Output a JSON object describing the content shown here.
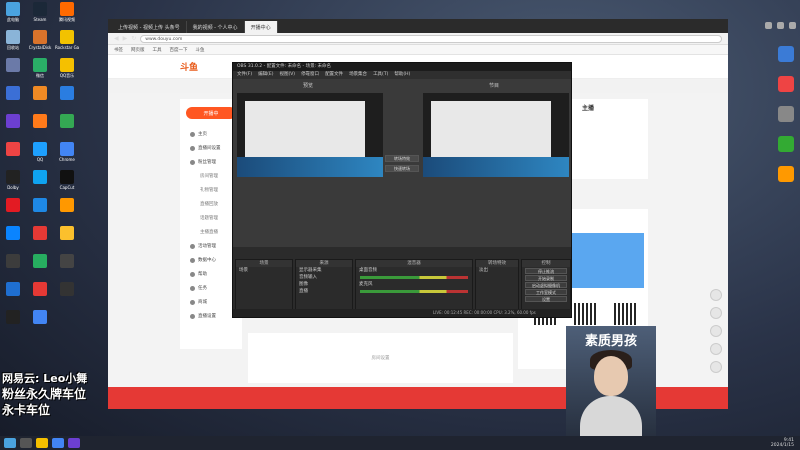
{
  "desktop": {
    "icons": [
      {
        "label": "此电脑",
        "color": "#4aa3df"
      },
      {
        "label": "Steam",
        "color": "#1b2838"
      },
      {
        "label": "腾讯视频",
        "color": "#ff6a00"
      },
      {
        "label": "",
        "color": ""
      },
      {
        "label": "回收站",
        "color": "#8ab4d8"
      },
      {
        "label": "CrystalDisk",
        "color": "#d9732b"
      },
      {
        "label": "Rockstar Games",
        "color": "#f2c200"
      },
      {
        "label": "",
        "color": ""
      },
      {
        "label": "",
        "color": "#6b7aa8"
      },
      {
        "label": "微信",
        "color": "#2aae67"
      },
      {
        "label": "QQ音乐",
        "color": "#f5c000"
      },
      {
        "label": "",
        "color": ""
      },
      {
        "label": "",
        "color": "#3b6fd6"
      },
      {
        "label": "",
        "color": "#f08a24"
      },
      {
        "label": "",
        "color": "#2a7de1"
      },
      {
        "label": "",
        "color": ""
      },
      {
        "label": "",
        "color": "#6c3fd1"
      },
      {
        "label": "",
        "color": "#ff7a1a"
      },
      {
        "label": "",
        "color": "#34a853"
      },
      {
        "label": "",
        "color": ""
      },
      {
        "label": "",
        "color": "#e44"
      },
      {
        "label": "QQ",
        "color": "#1ea0ff"
      },
      {
        "label": "Chrome",
        "color": "#4285f4"
      },
      {
        "label": "",
        "color": ""
      },
      {
        "label": "Dolby",
        "color": "#222"
      },
      {
        "label": "",
        "color": "#0fa3f0"
      },
      {
        "label": "CapCut",
        "color": "#111"
      },
      {
        "label": "",
        "color": ""
      },
      {
        "label": "",
        "color": "#e31b23"
      },
      {
        "label": "",
        "color": "#1e88e5"
      },
      {
        "label": "",
        "color": "#ff9800"
      },
      {
        "label": "",
        "color": ""
      },
      {
        "label": "",
        "color": "#0a84ff"
      },
      {
        "label": "",
        "color": "#e53935"
      },
      {
        "label": "",
        "color": "#fbc02d"
      },
      {
        "label": "",
        "color": ""
      },
      {
        "label": "",
        "color": "#3c3c3c"
      },
      {
        "label": "",
        "color": "#27ae60"
      },
      {
        "label": "",
        "color": "#444"
      },
      {
        "label": "",
        "color": ""
      },
      {
        "label": "",
        "color": "#1f6fd1"
      },
      {
        "label": "",
        "color": "#e53935"
      },
      {
        "label": "",
        "color": "#333"
      },
      {
        "label": "",
        "color": ""
      },
      {
        "label": "",
        "color": "#222"
      },
      {
        "label": "",
        "color": "#4285f4"
      },
      {
        "label": "",
        "color": ""
      },
      {
        "label": "",
        "color": ""
      }
    ]
  },
  "browser": {
    "tabs": [
      "上传视频 - 视频上传 头条号",
      "我的视频 - 个人中心",
      "开播中心"
    ],
    "url": "www.douyu.com",
    "bookmarks": [
      "书签",
      "网页版",
      "工具",
      "百度一下",
      "斗鱼"
    ],
    "site_logo": "斗鱼",
    "live_button": "开播中",
    "nav": [
      {
        "label": "主页",
        "sub": false
      },
      {
        "label": "直播间设置",
        "sub": false
      },
      {
        "label": "粉丝管理",
        "sub": false
      },
      {
        "label": "房间管理",
        "sub": true
      },
      {
        "label": "礼物管理",
        "sub": true
      },
      {
        "label": "直播回放",
        "sub": true
      },
      {
        "label": "话题管理",
        "sub": true
      },
      {
        "label": "主播直播",
        "sub": true
      },
      {
        "label": "活动管理",
        "sub": false
      },
      {
        "label": "数据中心",
        "sub": false
      },
      {
        "label": "帮助",
        "sub": false
      },
      {
        "label": "任务",
        "sub": false
      },
      {
        "label": "商城",
        "sub": false
      },
      {
        "label": "直播设置",
        "sub": false
      }
    ],
    "right_card_title": "主播",
    "center_hint": "房间设置"
  },
  "obs": {
    "title": "OBS 31.0.2 - 配置文件: 未命名 - 场景: 未命名",
    "menu": [
      "文件(F)",
      "编辑(E)",
      "视图(V)",
      "停靠窗口",
      "配置文件",
      "场景集合",
      "工具(T)",
      "帮助(H)"
    ],
    "preview_label": "预览",
    "program_label": "节目",
    "transition_buttons": [
      "转场特效",
      "快速转场"
    ],
    "docks": {
      "scenes": {
        "title": "场景",
        "items": [
          "场景"
        ]
      },
      "sources": {
        "title": "来源",
        "items": [
          "显示器采集",
          "音频输入",
          "图像",
          "直播"
        ]
      },
      "mixer": {
        "title": "混音器",
        "items": [
          "桌面音频",
          "麦克风"
        ]
      },
      "transitions": {
        "title": "转场特效",
        "items": [
          "淡出"
        ]
      },
      "controls": {
        "title": "控制",
        "items": [
          "停止推流",
          "开始录制",
          "启动虚拟摄像机",
          "工作室模式",
          "设置",
          "退出"
        ]
      }
    },
    "status": "LIVE: 00:12:45  REC: 00:00:00  CPU: 3.2%, 60.00 fps"
  },
  "overlay": {
    "line1": "网易云: Leo小舞",
    "line2": "粉丝永久牌车位",
    "line3": "永卡车位",
    "webcam_caption": "素质男孩"
  },
  "taskbar": {
    "time": "9:41",
    "date": "2024/1/15"
  }
}
